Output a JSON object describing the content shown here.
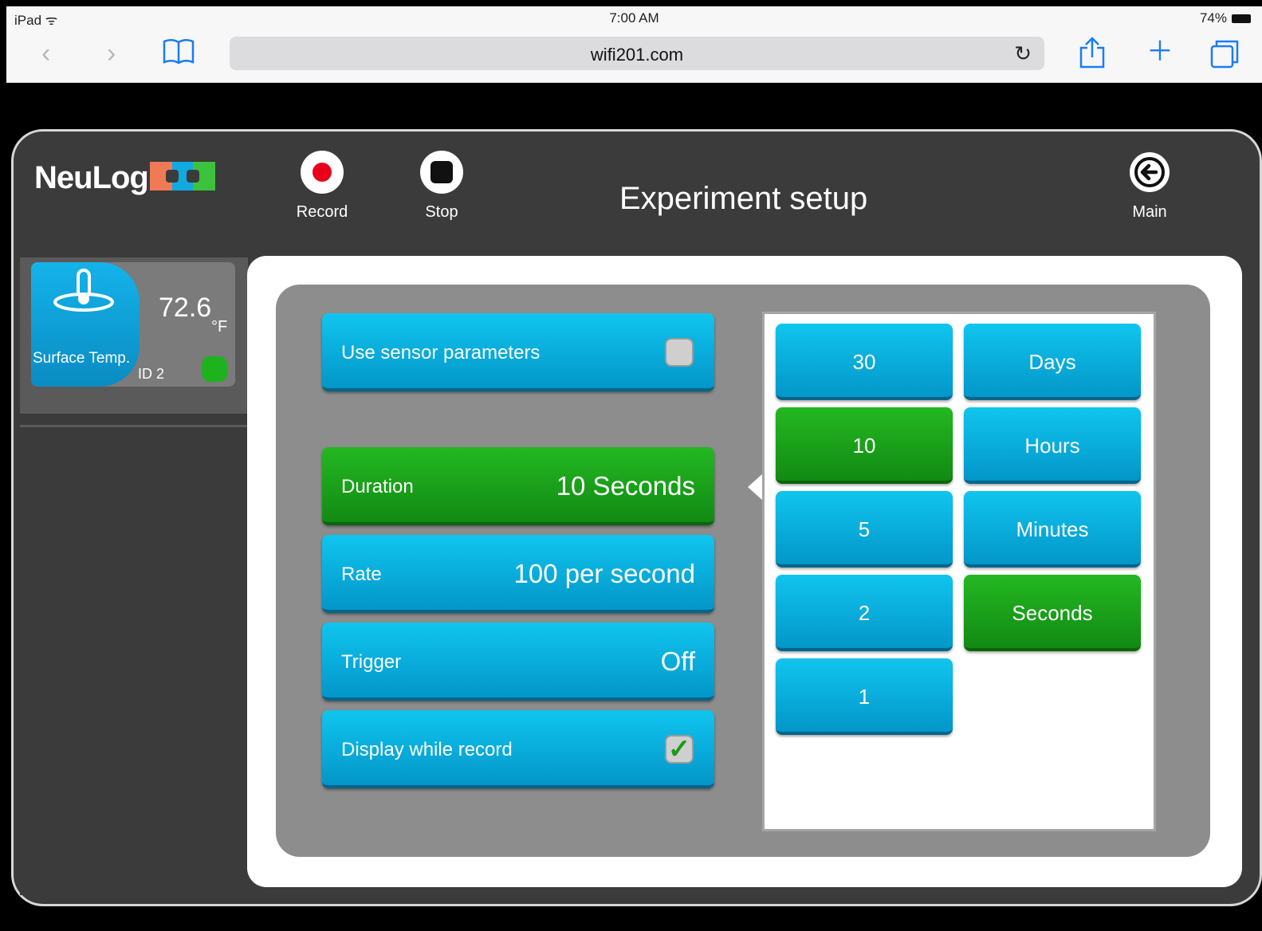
{
  "status": {
    "device": "iPad",
    "time": "7:00 AM",
    "battery": "74%"
  },
  "browser": {
    "url": "wifi201.com"
  },
  "app": {
    "logo": "NeuLog",
    "title": "Experiment setup",
    "toolbar": {
      "record_label": "Record",
      "stop_label": "Stop",
      "main_label": "Main"
    }
  },
  "sensor": {
    "name": "Surface Temp.",
    "value": "72.6",
    "unit": "°F",
    "id": "ID 2"
  },
  "options": [
    {
      "label": "Use sensor parameters",
      "checked": false
    },
    {
      "label": "Duration",
      "value": "10 Seconds",
      "selected": true
    },
    {
      "label": "Rate",
      "value": "100 per second"
    },
    {
      "label": "Trigger",
      "value": "Off"
    },
    {
      "label": "Display while record",
      "checked": true
    }
  ],
  "picker": {
    "numbers": [
      "30",
      "10",
      "5",
      "2",
      "1"
    ],
    "units": [
      "Days",
      "Hours",
      "Minutes",
      "Seconds"
    ],
    "selected_number": "10",
    "selected_unit": "Seconds"
  },
  "colors": {
    "accent_blue": "#0aa9dc",
    "selected_green": "#1ea51c",
    "record_red": "#e8001a"
  }
}
